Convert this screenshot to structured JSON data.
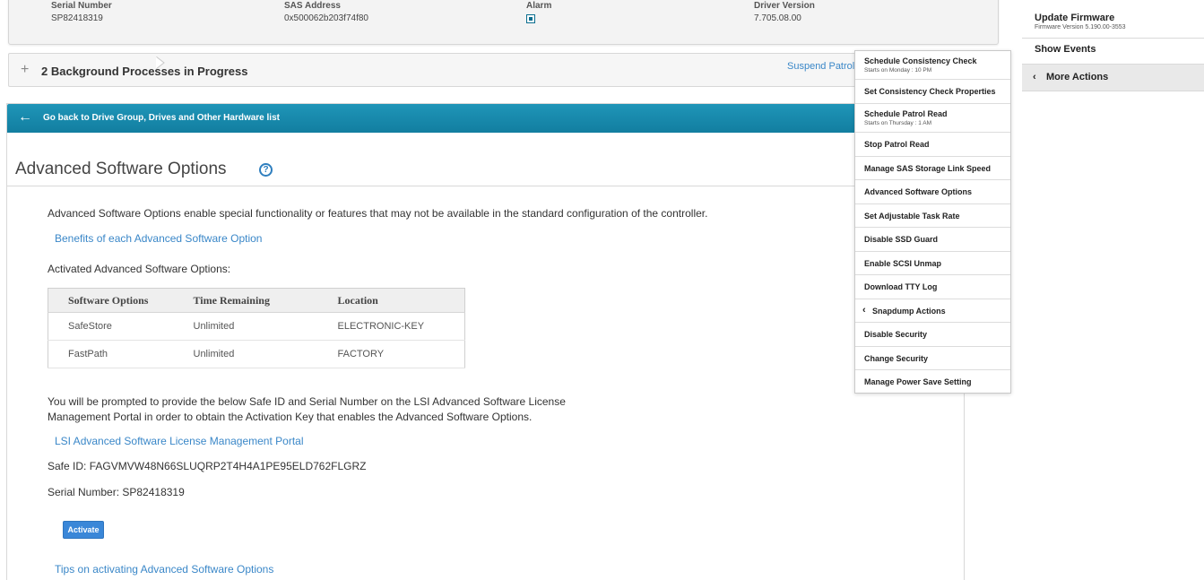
{
  "info": {
    "serial_label": "Serial Number",
    "serial_value": "SP82418319",
    "sas_label": "SAS Address",
    "sas_value": "0x500062b203f74f80",
    "alarm_label": "Alarm",
    "driver_label": "Driver Version",
    "driver_value": "7.705.08.00"
  },
  "bg_processes": {
    "title": "2 Background Processes in Progress",
    "suspend_link": "Suspend Patrol"
  },
  "back_bar": {
    "label": "Go back to Drive Group, Drives and Other Hardware list"
  },
  "page": {
    "title": "Advanced Software Options",
    "help_icon": "?",
    "intro": "Advanced Software Options enable special functionality or features that may not be available in the standard configuration of the controller.",
    "benefits_link": "Benefits of each Advanced Software Option",
    "activated_heading": "Activated Advanced Software Options:",
    "table": {
      "headers": [
        "Software Options",
        "Time Remaining",
        "Location"
      ],
      "rows": [
        [
          "SafeStore",
          "Unlimited",
          "ELECTRONIC-KEY"
        ],
        [
          "FastPath",
          "Unlimited",
          "FACTORY"
        ]
      ]
    },
    "prompt_line1": "You will be prompted to provide the below Safe ID and Serial Number on the LSI Advanced Software License",
    "prompt_line2": "Management Portal in order to obtain the Activation Key that enables the Advanced Software Options.",
    "portal_link": "LSI Advanced Software License Management Portal",
    "safe_id": "Safe ID: FAGVMVW48N66SLUQRP2T4H4A1PE95ELD762FLGRZ",
    "serial_number": "Serial Number: SP82418319",
    "activate_button": "Activate",
    "tips_link": "Tips on activating Advanced Software Options"
  },
  "sidebar": {
    "update_firmware": "Update Firmware",
    "firmware_version": "Firmware Version 5.190.00-3553",
    "show_events": "Show Events",
    "more_actions": "More Actions"
  },
  "dropdown": {
    "items": [
      {
        "label": "Schedule Consistency Check",
        "sub": "Starts on Monday : 10 PM"
      },
      {
        "label": "Set Consistency Check Properties"
      },
      {
        "label": "Schedule Patrol Read",
        "sub": "Starts on Thursday : 1 AM"
      },
      {
        "label": "Stop Patrol Read"
      },
      {
        "label": "Manage SAS Storage Link Speed"
      },
      {
        "label": "Advanced Software Options"
      },
      {
        "label": "Set Adjustable Task Rate"
      },
      {
        "label": "Disable SSD Guard"
      },
      {
        "label": "Enable SCSI Unmap"
      },
      {
        "label": "Download TTY Log"
      },
      {
        "label": "Snapdump Actions"
      },
      {
        "label": "Disable Security"
      },
      {
        "label": "Change Security"
      },
      {
        "label": "Manage Power Save Setting"
      }
    ]
  }
}
